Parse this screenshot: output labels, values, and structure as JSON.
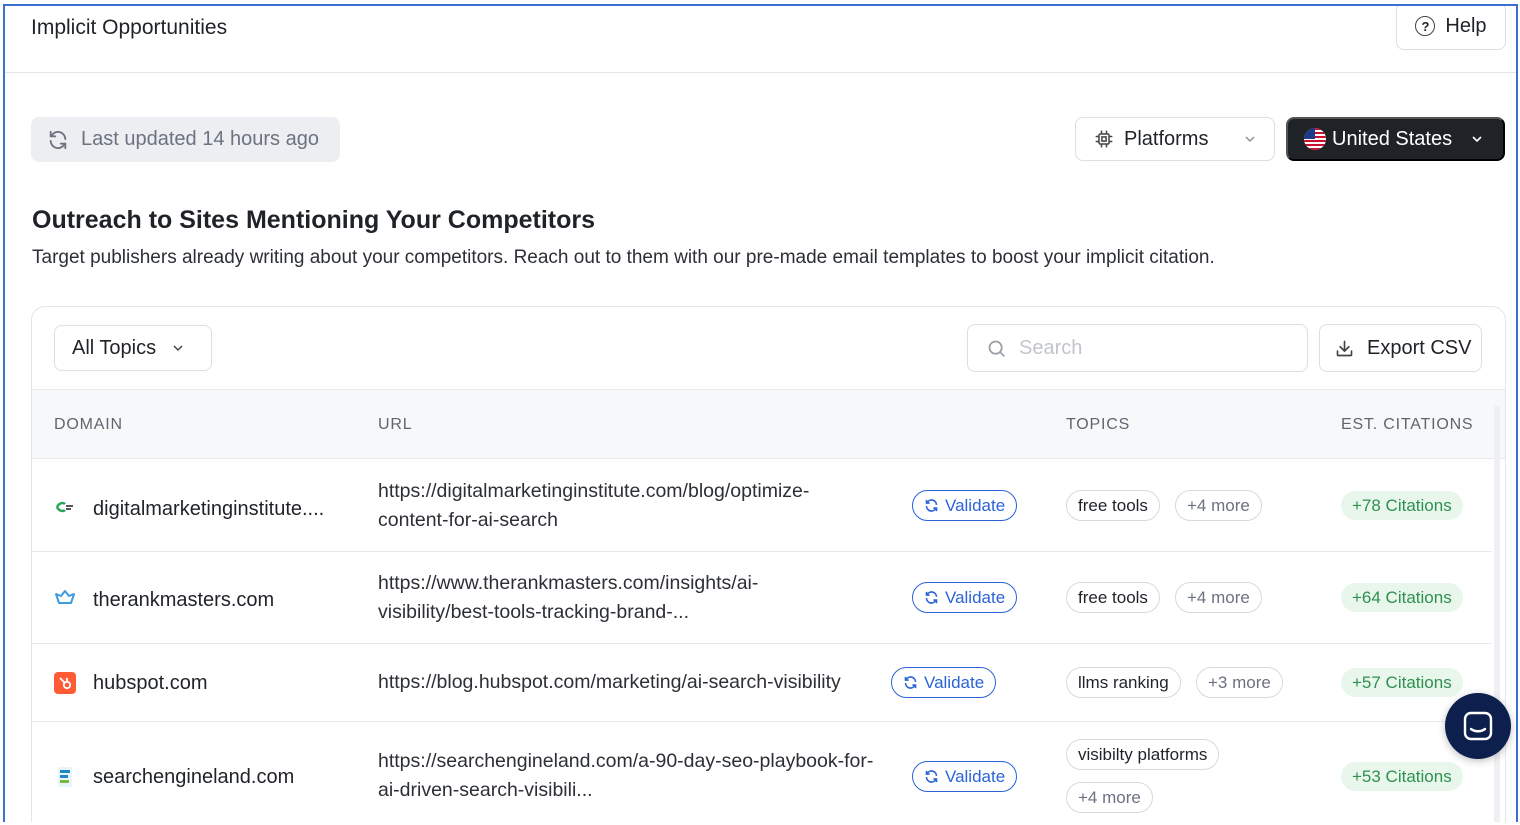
{
  "header": {
    "title": "Implicit Opportunities",
    "help_label": "Help"
  },
  "toolbar": {
    "last_updated": "Last updated 14 hours ago",
    "platforms_label": "Platforms",
    "country_label": "United States"
  },
  "section": {
    "title": "Outreach to Sites Mentioning Your Competitors",
    "description": "Target publishers already writing about your competitors. Reach out to them with our pre-made email templates to boost your implicit citation."
  },
  "filters": {
    "topics_label": "All Topics",
    "search_placeholder": "Search",
    "export_label": "Export CSV"
  },
  "table": {
    "columns": [
      "DOMAIN",
      "URL",
      "TOPICS",
      "EST. CITATIONS"
    ],
    "validate_label": "Validate",
    "rows": [
      {
        "domain": "digitalmarketinginstitute....",
        "url": "https://digitalmarketinginstitute.com/blog/optimize-content-for-ai-search",
        "topic": "free tools",
        "more": "+4 more",
        "citations": "+78 Citations"
      },
      {
        "domain": "therankmasters.com",
        "url": "https://www.therankmasters.com/insights/ai-visibility/best-tools-tracking-brand-...",
        "topic": "free tools",
        "more": "+4 more",
        "citations": "+64 Citations"
      },
      {
        "domain": "hubspot.com",
        "url": "https://blog.hubspot.com/marketing/ai-search-visibility",
        "topic": "llms ranking",
        "more": "+3 more",
        "citations": "+57 Citations"
      },
      {
        "domain": "searchengineland.com",
        "url": "https://searchengineland.com/a-90-day-seo-playbook-for-ai-driven-search-visibili...",
        "topic": "visibilty platforms",
        "more": "+4 more",
        "citations": "+53 Citations"
      }
    ]
  },
  "colors": {
    "accent": "#2b63d9",
    "citation_green": "#2e9150",
    "dark_button": "#1f2328",
    "chat_bg": "#0d1f4d"
  }
}
